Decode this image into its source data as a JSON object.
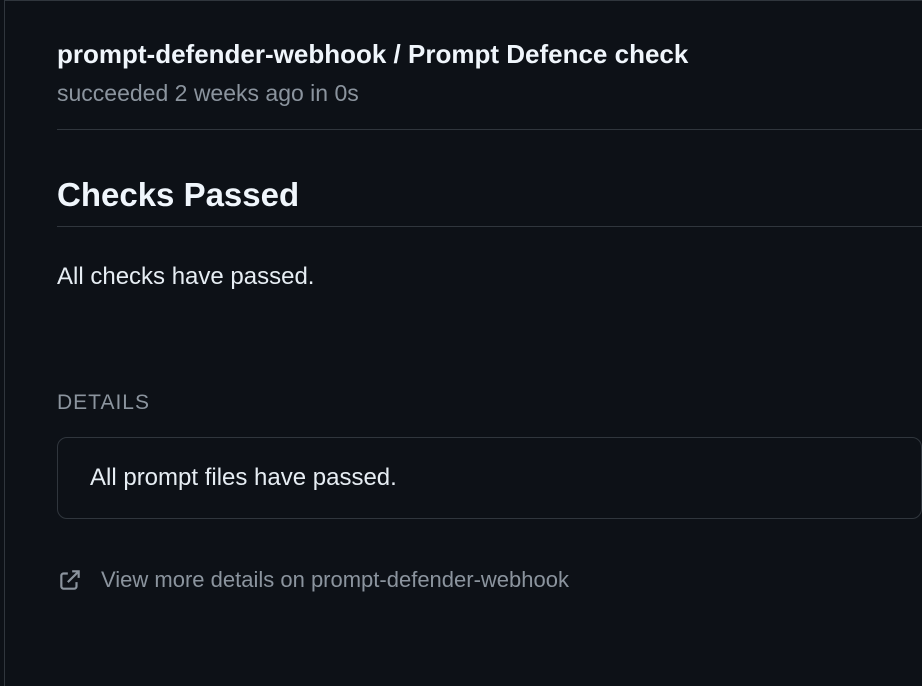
{
  "check": {
    "title": "prompt-defender-webhook / Prompt Defence check",
    "status_verb": "succeeded",
    "time_ago": "2 weeks ago",
    "duration_prefix": "in",
    "duration": "0s"
  },
  "result": {
    "heading": "Checks Passed",
    "body": "All checks have passed."
  },
  "details": {
    "label": "DETAILS",
    "message": "All prompt files have passed."
  },
  "footer": {
    "view_more_prefix": "View more details on",
    "app_name": "prompt-defender-webhook"
  }
}
